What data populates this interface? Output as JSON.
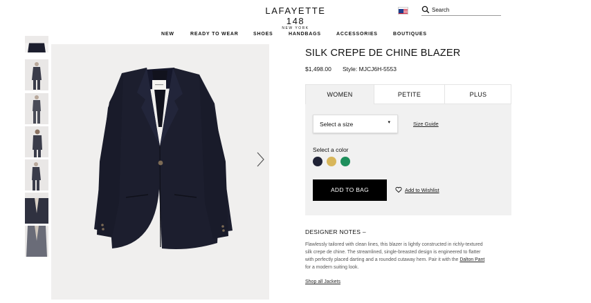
{
  "header": {
    "brand": "LAFAYETTE 148",
    "brand_sub": "NEW YORK",
    "search_placeholder": "Search"
  },
  "nav": {
    "items": [
      "NEW",
      "READY TO WEAR",
      "SHOES",
      "HANDBAGS",
      "ACCESSORIES",
      "BOUTIQUES"
    ]
  },
  "product": {
    "title": "SILK CREPE DE CHINE BLAZER",
    "price": "$1,498.00",
    "style": "Style: MJCJ6H-5553",
    "tabs": [
      "WOMEN",
      "PETITE",
      "PLUS"
    ],
    "active_tab": "WOMEN",
    "size_select_label": "Select a size",
    "size_caret": "▾",
    "size_guide": "Size Guide",
    "color_label": "Select a color",
    "colors": [
      "#1f2235",
      "#d8b65a",
      "#1e8f5c"
    ],
    "add_to_bag": "ADD TO BAG",
    "wishlist": "Add to Wishlist"
  },
  "notes": {
    "title": "DESIGNER NOTES –",
    "body_before_link": "Flawlessly tailored with clean lines, this blazer is lightly constructed in richly-textured silk crepe de chine. The streamlined, single-breasted design is engineered to flatter with perfectly placed darting and a rounded cutaway hem. Pair it with the ",
    "link": "Dalton Pant",
    "body_after_link": " for a modern suiting look.",
    "shop_all": "Shop all Jackets"
  },
  "gallery": {
    "thumbnail_count": 7,
    "jacket_color": "#1c1e2e"
  }
}
